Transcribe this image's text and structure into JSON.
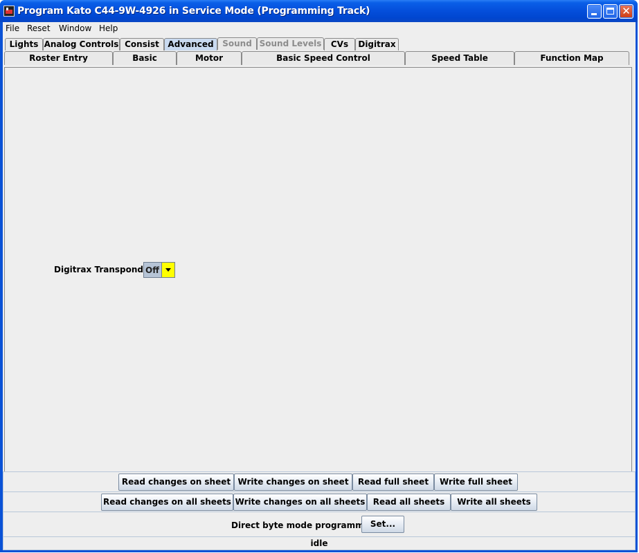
{
  "window": {
    "title": "Program Kato C44-9W-4926 in Service Mode (Programming Track)",
    "colors": {
      "titlebar": "#0550dc",
      "selected_tab": "#c9daf0",
      "combo_arrow": "#ffff00"
    }
  },
  "menu": [
    "File",
    "Reset",
    "Window",
    "Help"
  ],
  "tabs_row1": [
    "Lights",
    "Analog Controls",
    "Consist",
    "Advanced",
    "Sound",
    "Sound Levels",
    "CVs",
    "Digitrax"
  ],
  "tabs_row1_selected": "Advanced",
  "tabs_row1_disabled": [
    "Sound",
    "Sound Levels"
  ],
  "tabs_row2": [
    "Roster Entry",
    "Basic",
    "Motor",
    "Basic Speed Control",
    "Speed Table",
    "Function Map"
  ],
  "content": {
    "transponding_label": "Digitrax Transponding",
    "transponding_value": "Off"
  },
  "sheet_buttons": [
    "Read changes on sheet",
    "Write changes on sheet",
    "Read full sheet",
    "Write full sheet"
  ],
  "all_sheet_buttons": [
    "Read changes on all sheets",
    "Write changes on all sheets",
    "Read all sheets",
    "Write all sheets"
  ],
  "programming": {
    "mode_label": "Direct byte mode programming",
    "set_button": "Set..."
  },
  "status": "idle"
}
